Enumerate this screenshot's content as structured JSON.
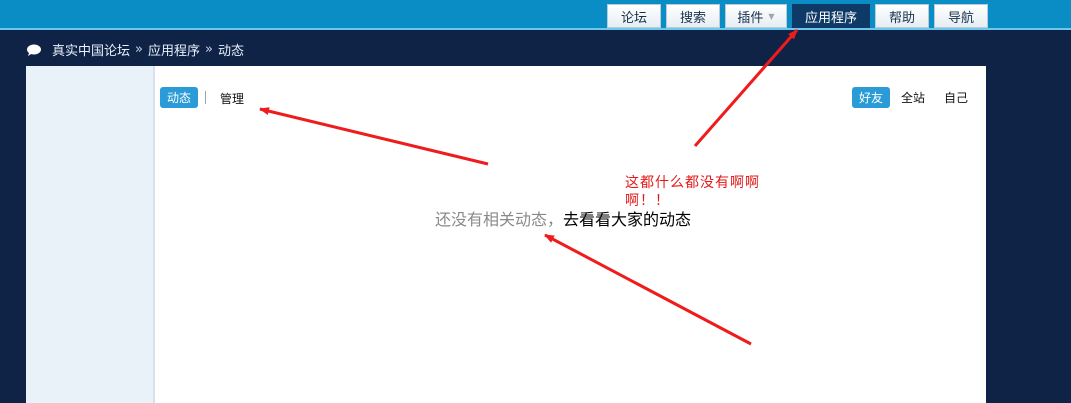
{
  "nav": {
    "items": [
      {
        "label": "论坛"
      },
      {
        "label": "搜索"
      },
      {
        "label": "插件"
      },
      {
        "label": "应用程序"
      },
      {
        "label": "帮助"
      },
      {
        "label": "导航"
      }
    ]
  },
  "breadcrumb": {
    "items": [
      "真实中国论坛",
      "应用程序",
      "动态"
    ],
    "separator": "»"
  },
  "tabs": {
    "active_label": "动态",
    "manage_label": "管理"
  },
  "filters": {
    "friends": "好友",
    "site": "全站",
    "self": "自己"
  },
  "empty_state": {
    "muted_text": "还没有相关动态，",
    "link_text": "去看看大家的动态"
  },
  "annotation": {
    "text": "这都什么都没有啊啊啊！！"
  },
  "colors": {
    "topbar": "#0a8cc4",
    "page_bg": "#0f2347",
    "nav_active": "#0f3a68",
    "tab_active": "#2a9bd6",
    "annotation": "#e41a1a"
  }
}
